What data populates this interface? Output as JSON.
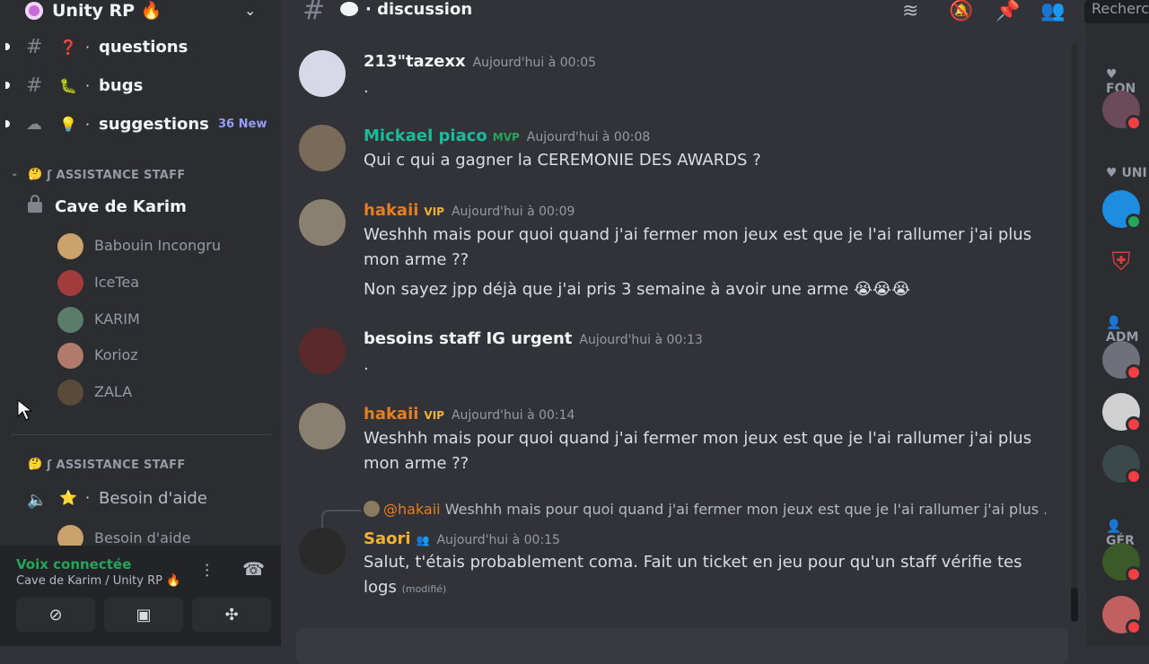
{
  "server": {
    "name": "Unity RP 🔥"
  },
  "channels": [
    {
      "emoji": "❓",
      "name": "questions",
      "badge": ""
    },
    {
      "emoji": "🐛",
      "name": "bugs",
      "badge": ""
    },
    {
      "emoji": "💡",
      "name": "suggestions",
      "badge": "36 New"
    }
  ],
  "categories": [
    {
      "emoji": "🤔",
      "label": "ʃ ASSISTANCE STAFF"
    },
    {
      "emoji": "🤔",
      "label": "ʃ ASSISTANCE STAFF"
    }
  ],
  "voice_channel": {
    "name": "Cave de Karim"
  },
  "voice_members": [
    {
      "name": "Babouin Incongru",
      "color": "#c9a36b"
    },
    {
      "name": "IceTea",
      "color": "#a23b3b"
    },
    {
      "name": "KARIM",
      "color": "#5a7c6a"
    },
    {
      "name": "Korioz",
      "color": "#b07b6b"
    },
    {
      "name": "ZALA",
      "color": "#5b4a3a"
    }
  ],
  "help_channel": {
    "emoji": "⭐",
    "name": "Besoin d'aide",
    "sub": "Besoin d'aide"
  },
  "voice_panel": {
    "status": "Voix connectée",
    "location": "Cave de Karim / Unity RP 🔥"
  },
  "topbar": {
    "channel": "discussion",
    "search_placeholder": "Recherc"
  },
  "messages": [
    {
      "user": "213\"tazexx",
      "color": "#f2f3f5",
      "tag": "",
      "time": "Aujourd'hui à 00:05",
      "lines": [
        "."
      ],
      "avatar": "#d8d8e8"
    },
    {
      "user": "Mickael piaco",
      "color": "#1abc9c",
      "tag": "MVP",
      "tag_color": "#23a55a",
      "time": "Aujourd'hui à 00:08",
      "lines": [
        "Qui c qui a gagner la CEREMONIE DES AWARDS ?"
      ],
      "avatar": "#7a6a5a"
    },
    {
      "user": "hakaii",
      "color": "#e67e22",
      "tag": "VIP",
      "tag_color": "#f0b232",
      "time": "Aujourd'hui à 00:09",
      "lines": [
        "Weshhh mais pour quoi quand j'ai fermer mon jeux est que je l'ai rallumer j'ai plus",
        "mon arme ??",
        "Non sayez jpp déjà que j'ai pris 3 semaine à avoir une arme 😭😭😭"
      ],
      "avatar": "#8a8070"
    },
    {
      "user": "besoins staff IG urgent",
      "color": "#f2f3f5",
      "tag": "",
      "time": "Aujourd'hui à 00:13",
      "lines": [
        "."
      ],
      "avatar": "#5a2a2a"
    },
    {
      "user": "hakaii",
      "color": "#e67e22",
      "tag": "VIP",
      "tag_color": "#f0b232",
      "time": "Aujourd'hui à 00:14",
      "lines": [
        "Weshhh mais pour quoi quand j'ai fermer mon jeux est que je l'ai rallumer j'ai plus",
        "mon arme ??"
      ],
      "avatar": "#8a8070"
    },
    {
      "user": "Saori",
      "color": "#f0b232",
      "tag": "",
      "time": "Aujourd'hui à 00:15",
      "lines": [
        "Salut, t'étais probablement coma. Fait un ticket en jeu pour qu'un staff vérifie tes",
        "logs"
      ],
      "edited": "(modifié)",
      "avatar": "#2a2a2a"
    }
  ],
  "reply": {
    "mention": "@hakaii",
    "preview": "Weshhh mais pour quoi quand j'ai fermer mon jeux est que je l'ai rallumer j'ai plus ..."
  },
  "member_groups": [
    "FON",
    "UNI",
    "ADM",
    "GÉR"
  ]
}
